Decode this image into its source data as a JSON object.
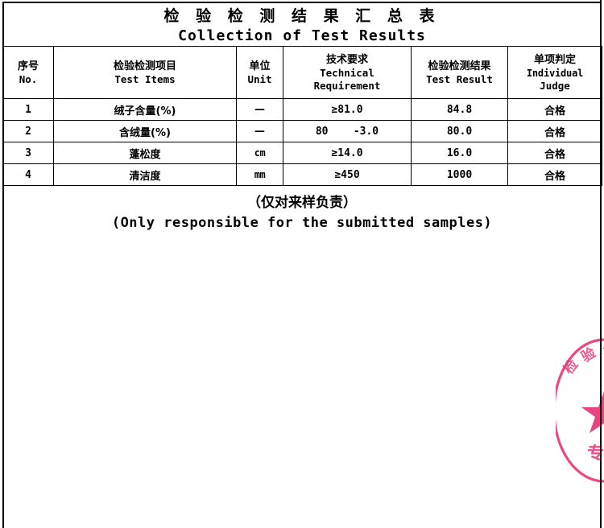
{
  "document": {
    "title_cn": "检 验 检 测 结 果 汇 总 表",
    "title_en": "Collection of Test Results"
  },
  "table": {
    "headers": [
      {
        "cn": "序号",
        "en": "No."
      },
      {
        "cn": "检验检测项目",
        "en": "Test Items"
      },
      {
        "cn": "单位",
        "en": "Unit"
      },
      {
        "cn": "技术要求",
        "en": "Technical",
        "en2": "Requirement"
      },
      {
        "cn": "检验检测结果",
        "en": "Test Result"
      },
      {
        "cn": "单项判定",
        "en": "Individual",
        "en2": "Judge"
      }
    ],
    "rows": [
      {
        "no": "1",
        "item": "绒子含量(%)",
        "unit": "—",
        "requirement": "≥81.0",
        "result": "84.8",
        "judge": "合格"
      },
      {
        "no": "2",
        "item": "含绒量(%)",
        "unit": "—",
        "requirement": "80    -3.0",
        "result": "80.0",
        "judge": "合格"
      },
      {
        "no": "3",
        "item": "蓬松度",
        "unit": "cm",
        "requirement": "≥14.0",
        "result": "16.0",
        "judge": "合格"
      },
      {
        "no": "4",
        "item": "清洁度",
        "unit": "mm",
        "requirement": "≥450",
        "result": "1000",
        "judge": "合格"
      }
    ]
  },
  "notes": {
    "cn": "（仅对来样负责）",
    "en": "(Only responsible for the submitted samples)"
  },
  "stamp": {
    "text_cn": "专用",
    "color": "#e8397a"
  }
}
